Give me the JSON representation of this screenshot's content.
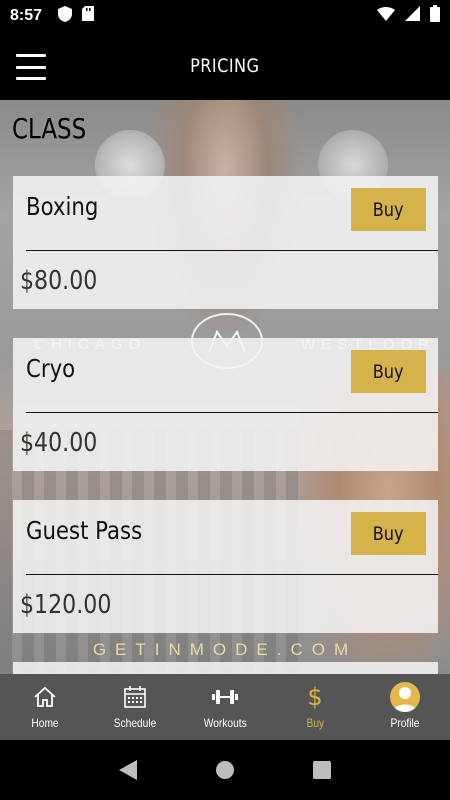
{
  "status_bar": {
    "time": "8:57",
    "icons": [
      "shield-icon",
      "sd-card-icon",
      "wifi-icon",
      "signal-icon",
      "battery-icon"
    ]
  },
  "app_bar": {
    "title": "PRICING",
    "menu_icon": "hamburger-menu-icon"
  },
  "section": {
    "title": "CLASS"
  },
  "background": {
    "brand_left": "CHICAGO",
    "brand_right": "WESTLOOP",
    "url": "GETINMODE.COM"
  },
  "products": [
    {
      "name": "Boxing",
      "price": "$80.00",
      "buy_label": "Buy"
    },
    {
      "name": "Cryo",
      "price": "$40.00",
      "buy_label": "Buy"
    },
    {
      "name": "Guest Pass",
      "price": "$120.00",
      "buy_label": "Buy"
    }
  ],
  "bottom_nav": {
    "items": [
      {
        "label": "Home",
        "icon": "home-icon"
      },
      {
        "label": "Schedule",
        "icon": "calendar-icon"
      },
      {
        "label": "Workouts",
        "icon": "dumbbell-icon"
      },
      {
        "label": "Buy",
        "icon": "dollar-icon",
        "active": true
      },
      {
        "label": "Profile",
        "icon": "avatar-icon"
      }
    ],
    "active_color": "#d6b24a"
  },
  "colors": {
    "accent": "#d6b24a",
    "bar": "#000000",
    "nav_bg": "#555555"
  }
}
